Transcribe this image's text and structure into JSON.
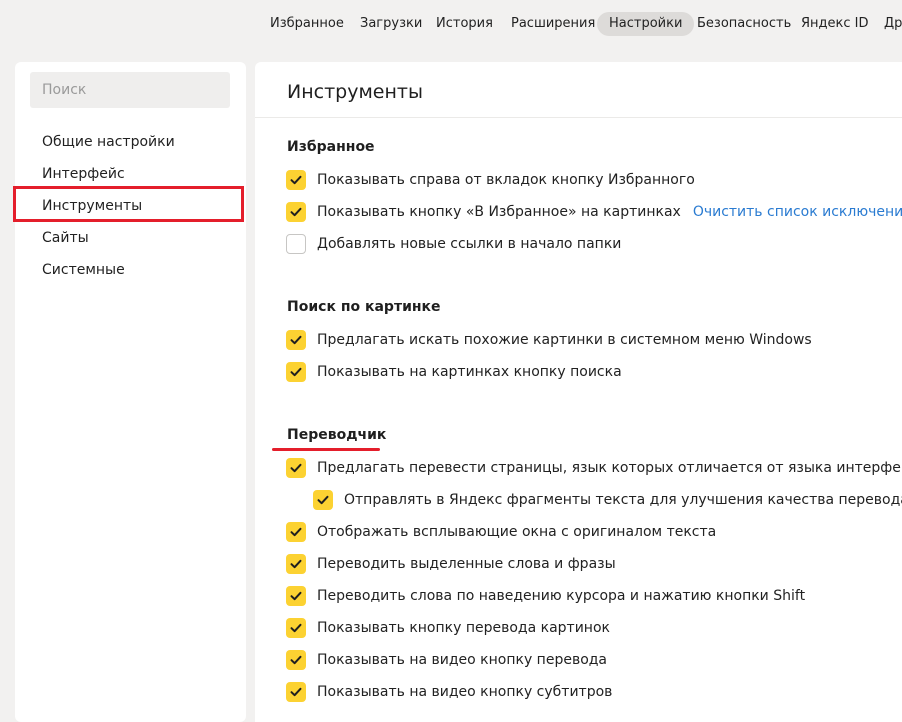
{
  "topnav": {
    "tabs": [
      {
        "label": "Избранное",
        "active": false
      },
      {
        "label": "Загрузки",
        "active": false
      },
      {
        "label": "История",
        "active": false
      },
      {
        "label": "Расширения",
        "active": false
      },
      {
        "label": "Настройки",
        "active": true
      },
      {
        "label": "Безопасность",
        "active": false
      },
      {
        "label": "Яндекс ID",
        "active": false
      },
      {
        "label": "Дру",
        "active": false
      }
    ]
  },
  "sidebar": {
    "search_placeholder": "Поиск",
    "items": [
      {
        "label": "Общие настройки"
      },
      {
        "label": "Интерфейс"
      },
      {
        "label": "Инструменты",
        "selected": true
      },
      {
        "label": "Сайты"
      },
      {
        "label": "Системные"
      }
    ]
  },
  "main": {
    "title": "Инструменты",
    "sections": [
      {
        "title": "Избранное",
        "options": [
          {
            "label": "Показывать справа от вкладок кнопку Избранного",
            "checked": true
          },
          {
            "label": "Показывать кнопку «В Избранное» на картинках",
            "checked": true,
            "link": "Очистить список исключений"
          },
          {
            "label": "Добавлять новые ссылки в начало папки",
            "checked": false
          }
        ]
      },
      {
        "title": "Поиск по картинке",
        "options": [
          {
            "label": "Предлагать искать похожие картинки в системном меню Windows",
            "checked": true
          },
          {
            "label": "Показывать на картинках кнопку поиска",
            "checked": true
          }
        ]
      },
      {
        "title": "Переводчик",
        "options": [
          {
            "label": "Предлагать перевести страницы, язык которых отличается от языка интерфейса",
            "checked": true
          },
          {
            "label": "Отправлять в Яндекс фрагменты текста для улучшения качества перевода",
            "checked": true,
            "indent": true
          },
          {
            "label": "Отображать всплывающие окна с оригиналом текста",
            "checked": true
          },
          {
            "label": "Переводить выделенные слова и фразы",
            "checked": true
          },
          {
            "label": "Переводить слова по наведению курсора и нажатию кнопки Shift",
            "checked": true
          },
          {
            "label": "Показывать кнопку перевода картинок",
            "checked": true
          },
          {
            "label": "Показывать на видео кнопку перевода",
            "checked": true
          },
          {
            "label": "Показывать на видео кнопку субтитров",
            "checked": true
          }
        ]
      }
    ]
  },
  "colors": {
    "accent_checkbox": "#fcd232",
    "highlight_red": "#e41e2b",
    "link_blue": "#2a7bd1"
  }
}
